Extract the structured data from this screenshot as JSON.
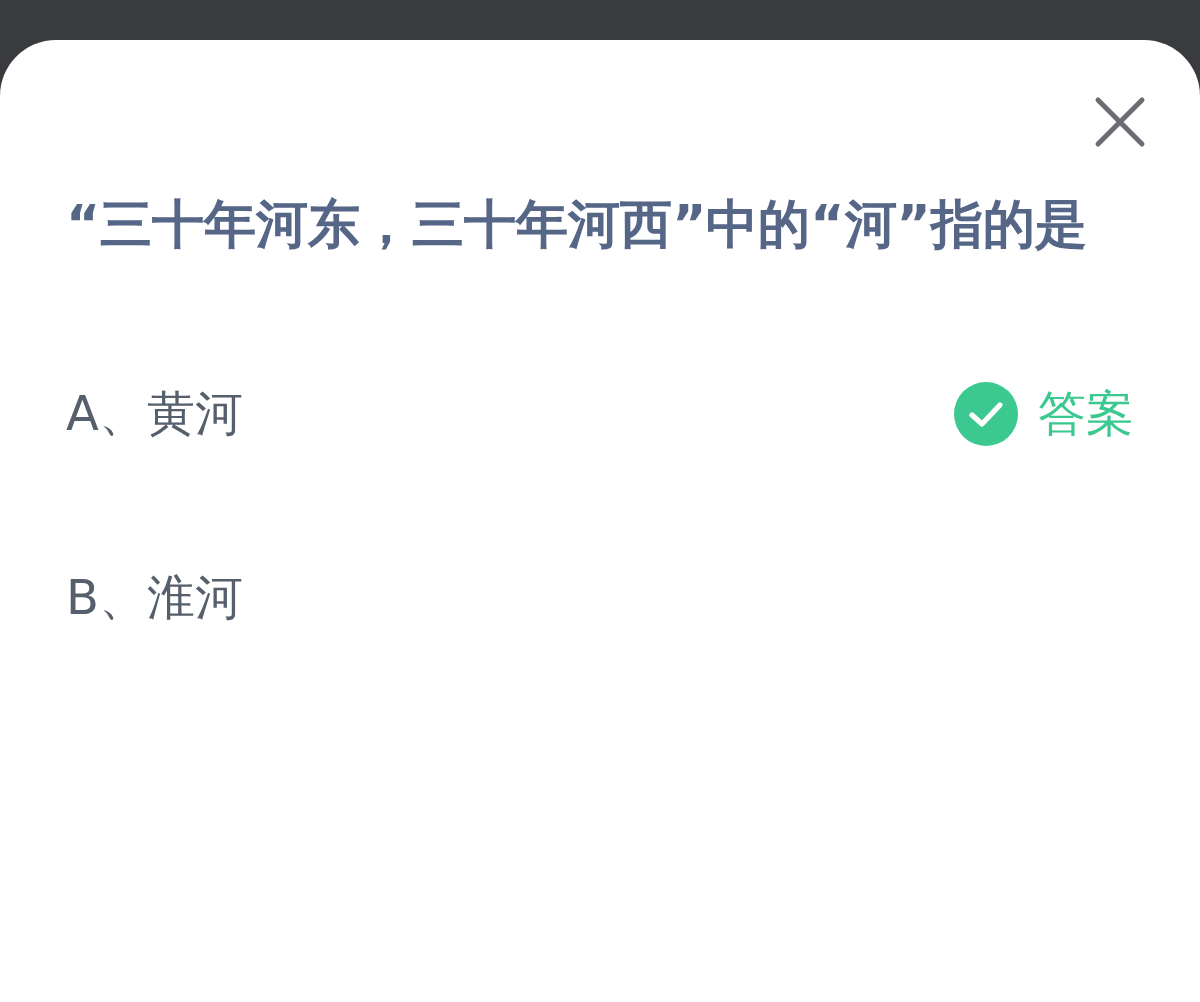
{
  "question": "“三十年河东，三十年河西”中的“河”指的是",
  "options": [
    {
      "label": "A、黄河",
      "is_answer": true,
      "answer_label": "答案"
    },
    {
      "label": "B、淮河",
      "is_answer": false
    }
  ]
}
